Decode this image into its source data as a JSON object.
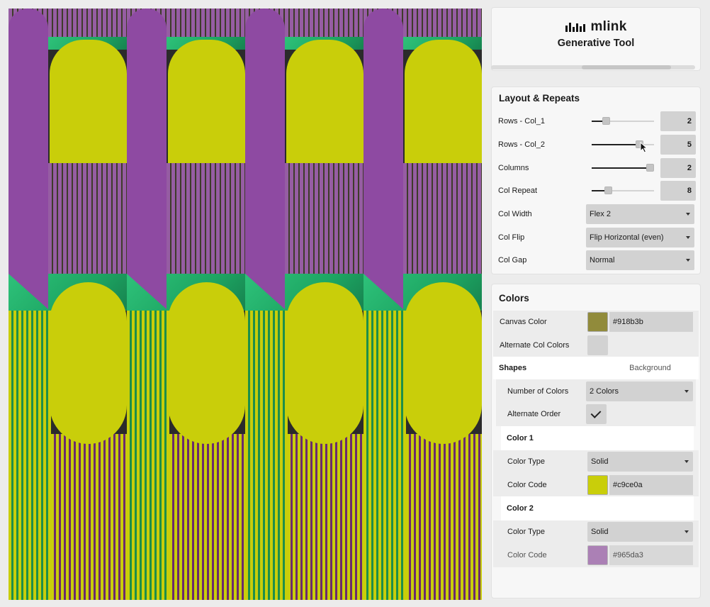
{
  "app": {
    "brand": "mlink",
    "subtitle": "Generative Tool"
  },
  "colors": {
    "canvas": "#918b3b",
    "shape1": "#c9ce0a",
    "shape2": "#965da3"
  },
  "layout": {
    "title": "Layout & Repeats",
    "rows": [
      {
        "label": "Rows - Col_1",
        "value": "2",
        "level": 0.2
      },
      {
        "label": "Rows - Col_2",
        "value": "5",
        "level": 0.8
      },
      {
        "label": "Columns",
        "value": "2",
        "level": 1.0
      },
      {
        "label": "Col Repeat",
        "value": "8",
        "level": 0.24
      }
    ],
    "col_width": {
      "label": "Col Width",
      "value": "Flex 2"
    },
    "col_flip": {
      "label": "Col Flip",
      "value": "Flip Horizontal (even)"
    },
    "col_gap": {
      "label": "Col Gap",
      "value": "Normal"
    }
  },
  "colors_section": {
    "title": "Colors",
    "canvas_color": {
      "label": "Canvas Color",
      "value": "#918b3b"
    },
    "alternate_col_colors": {
      "label": "Alternate Col Colors",
      "checked": false
    },
    "tabs": {
      "shapes": "Shapes",
      "background": "Background"
    },
    "number_of_colors": {
      "label": "Number of Colors",
      "value": "2 Colors"
    },
    "alternate_order": {
      "label": "Alternate Order",
      "checked": true
    },
    "color1": {
      "title": "Color 1",
      "type_label": "Color Type",
      "type_value": "Solid",
      "code_label": "Color Code",
      "code_value": "#c9ce0a"
    },
    "color2": {
      "title": "Color 2",
      "type_label": "Color Type",
      "type_value": "Solid",
      "code_label": "Color Code",
      "code_value": "#965da3"
    }
  }
}
